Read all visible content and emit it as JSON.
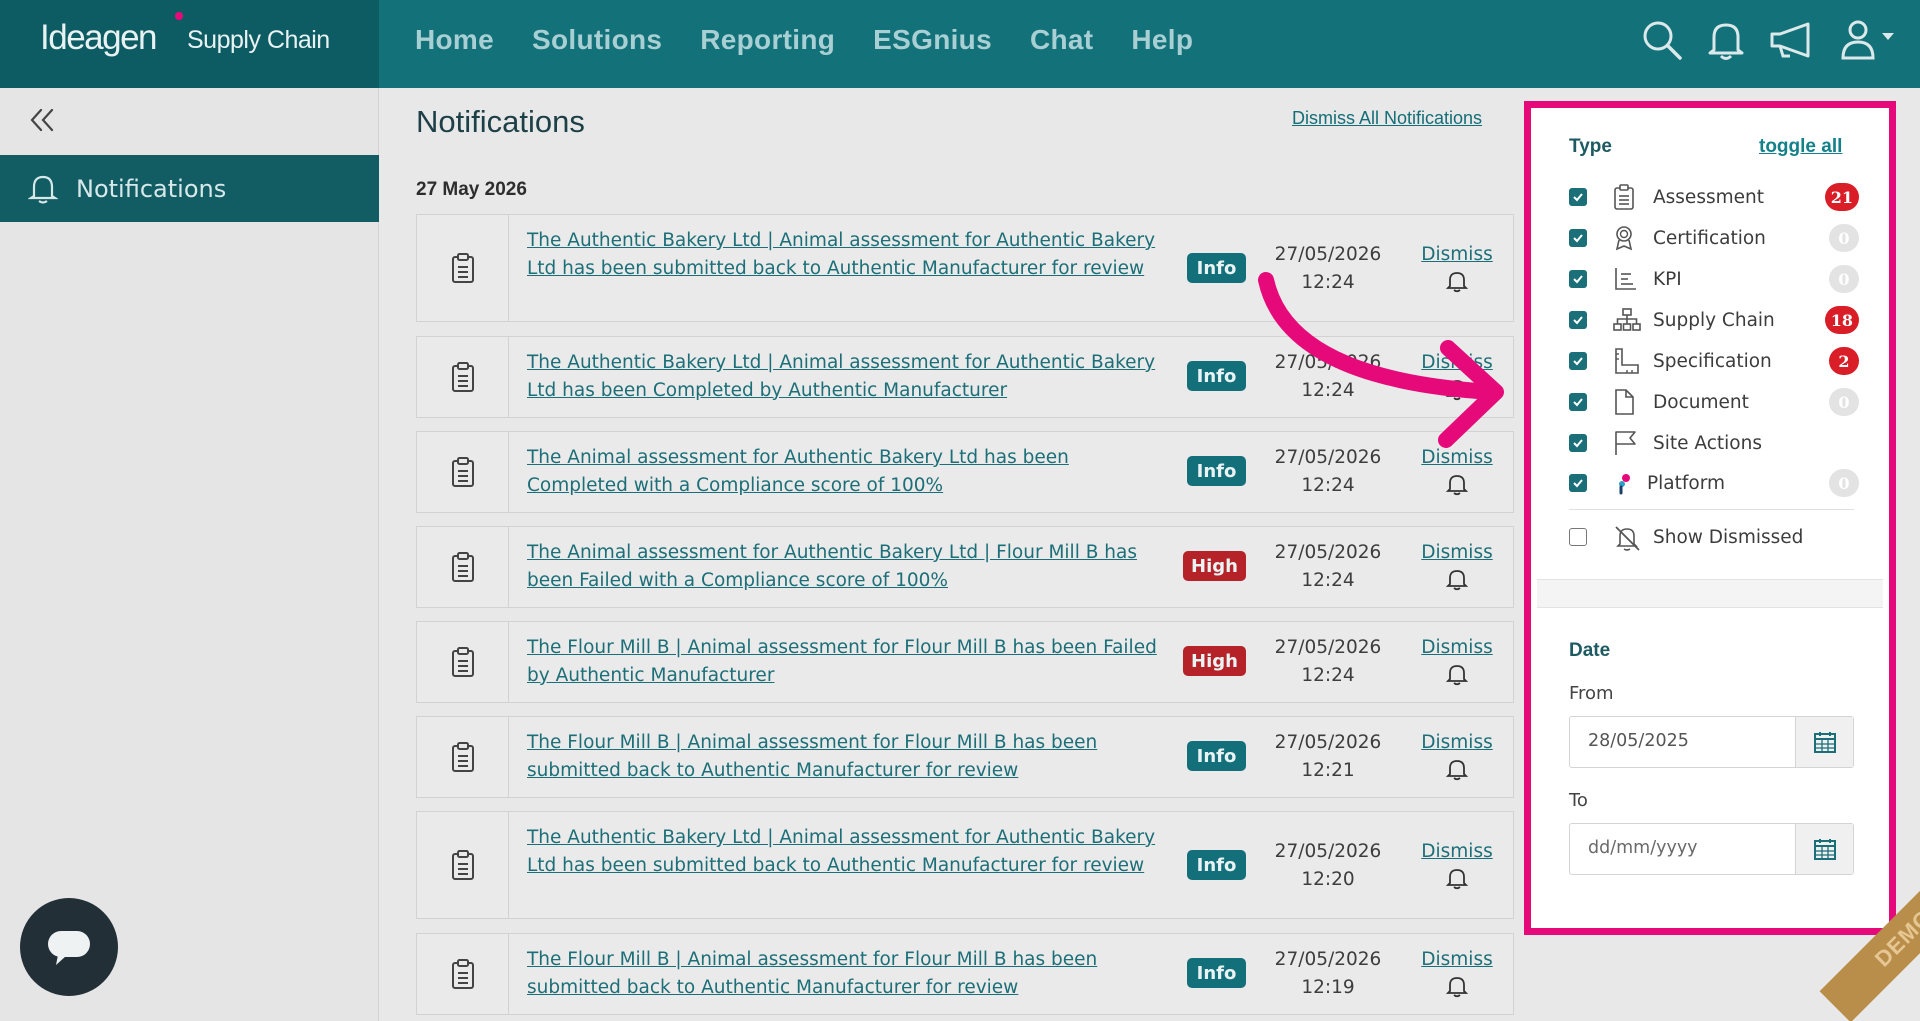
{
  "brand": {
    "logo": "Ideagen",
    "product": "Supply Chain"
  },
  "nav": [
    "Home",
    "Solutions",
    "Reporting",
    "ESGnius",
    "Chat",
    "Help"
  ],
  "top_icons": [
    "search-icon",
    "bell-icon",
    "megaphone-icon",
    "user-icon"
  ],
  "sidebar": {
    "items": [
      {
        "label": "Notifications",
        "icon": "bell-icon"
      }
    ]
  },
  "page": {
    "title": "Notifications",
    "dismiss_all": "Dismiss All Notifications",
    "date_group": "27 May 2026"
  },
  "notifications": [
    {
      "message": "The Authentic Bakery Ltd | Animal assessment for Authentic Bakery Ltd has been submitted back to Authentic Manufacturer for review",
      "level": "Info",
      "date": "27/05/2026",
      "time": "12:24",
      "dismiss": "Dismiss"
    },
    {
      "message": "The Authentic Bakery Ltd | Animal assessment for Authentic Bakery Ltd has been Completed by Authentic Manufacturer",
      "level": "Info",
      "date": "27/05/2026",
      "time": "12:24",
      "dismiss": "Dismiss"
    },
    {
      "message": "The Animal assessment for Authentic Bakery Ltd has been Completed with a Compliance score of 100%",
      "level": "Info",
      "date": "27/05/2026",
      "time": "12:24",
      "dismiss": "Dismiss"
    },
    {
      "message": "The Animal assessment for Authentic Bakery Ltd | Flour Mill B has been Failed with a Compliance score of 100%",
      "level": "High",
      "date": "27/05/2026",
      "time": "12:24",
      "dismiss": "Dismiss"
    },
    {
      "message": "The Flour Mill B | Animal assessment for Flour Mill B has been Failed by Authentic Manufacturer",
      "level": "High",
      "date": "27/05/2026",
      "time": "12:24",
      "dismiss": "Dismiss"
    },
    {
      "message": "The Flour Mill B | Animal assessment for Flour Mill B has been submitted back to Authentic Manufacturer for review",
      "level": "Info",
      "date": "27/05/2026",
      "time": "12:21",
      "dismiss": "Dismiss"
    },
    {
      "message": "The Authentic Bakery Ltd | Animal assessment for Authentic Bakery Ltd has been submitted back to Authentic Manufacturer for review",
      "level": "Info",
      "date": "27/05/2026",
      "time": "12:20",
      "dismiss": "Dismiss"
    },
    {
      "message": "The Flour Mill B | Animal assessment for Flour Mill B has been submitted back to Authentic Manufacturer for review",
      "level": "Info",
      "date": "27/05/2026",
      "time": "12:19",
      "dismiss": "Dismiss"
    }
  ],
  "filters": {
    "type_heading": "Type",
    "toggle_all": "toggle all",
    "types": [
      {
        "label": "Assessment",
        "checked": true,
        "count": "21",
        "count_style": "red",
        "icon": "clipboard-icon"
      },
      {
        "label": "Certification",
        "checked": true,
        "count": "0",
        "count_style": "grey",
        "icon": "award-icon"
      },
      {
        "label": "KPI",
        "checked": true,
        "count": "0",
        "count_style": "grey",
        "icon": "chart-icon"
      },
      {
        "label": "Supply Chain",
        "checked": true,
        "count": "18",
        "count_style": "red",
        "icon": "hierarchy-icon"
      },
      {
        "label": "Specification",
        "checked": true,
        "count": "2",
        "count_style": "red",
        "icon": "ruler-icon"
      },
      {
        "label": "Document",
        "checked": true,
        "count": "0",
        "count_style": "grey",
        "icon": "document-icon"
      },
      {
        "label": "Site Actions",
        "checked": true,
        "count": null,
        "count_style": null,
        "icon": "flag-icon"
      },
      {
        "label": "Platform",
        "checked": true,
        "count": "0",
        "count_style": "grey",
        "icon": "platform-logo-icon"
      }
    ],
    "show_dismissed": {
      "label": "Show Dismissed",
      "checked": false,
      "icon": "bell-off-icon"
    },
    "date_heading": "Date",
    "from_label": "From",
    "from_value": "28/05/2025",
    "to_label": "To",
    "to_placeholder": "dd/mm/yyyy"
  },
  "ribbon": "DEMO",
  "colors": {
    "brand": "#137179",
    "highlight": "#e6097a",
    "high": "#b52228",
    "info": "#13707a"
  }
}
